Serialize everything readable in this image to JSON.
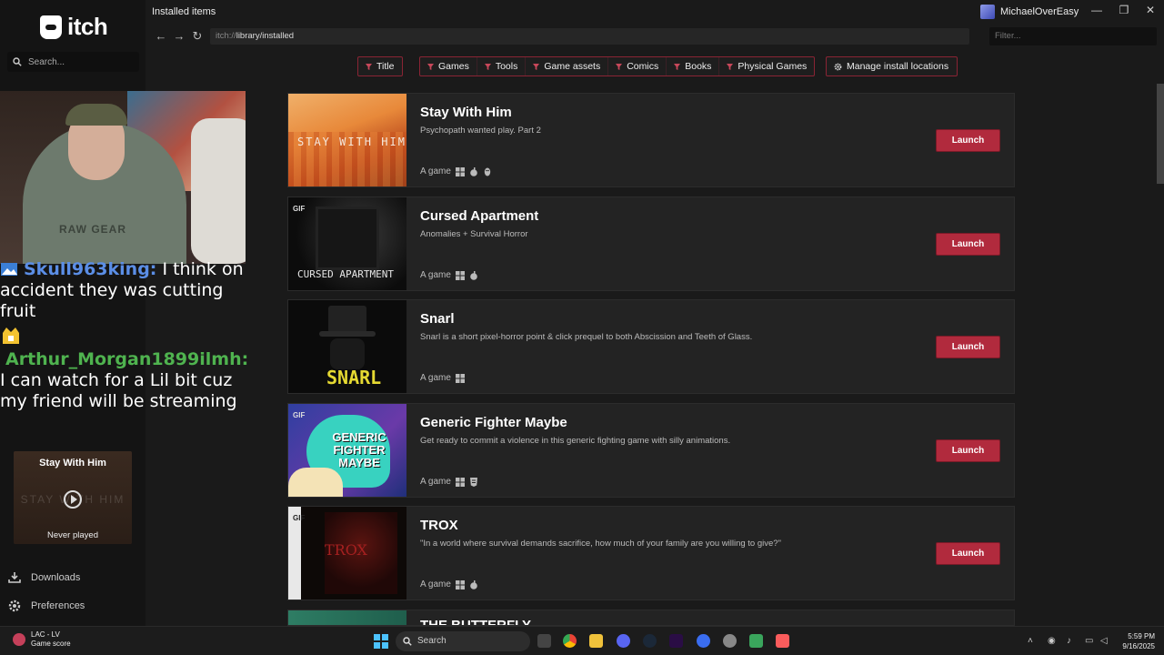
{
  "app": {
    "logo_text": "itch",
    "page_title": "Installed items",
    "url_proto": "itch://",
    "url_path": "library/installed",
    "filter_placeholder": "Filter...",
    "username": "MichaelOverEasy"
  },
  "sidebar": {
    "search_placeholder": "Search...",
    "downloads_label": "Downloads",
    "preferences_label": "Preferences",
    "now_playing": {
      "title": "Stay With Him",
      "status": "Never played",
      "ghost": "STAY WITH HIM"
    }
  },
  "chat": {
    "line1_user": "Skull963king:",
    "line1_text": " I think on accident they was cutting fruit",
    "line2_user": "Arthur_Morgan1899ilmh:",
    "line2_text": "I can watch for a Lil bit cuz my friend will be streaming"
  },
  "webcam": {
    "shirt_print": "RAW GEAR"
  },
  "filters": {
    "title": "Title",
    "categories": [
      "Games",
      "Tools",
      "Game assets",
      "Comics",
      "Books",
      "Physical Games"
    ],
    "manage": "Manage install locations"
  },
  "games": [
    {
      "title": "Stay With Him",
      "desc": "Psychopath wanted play. Part 2",
      "kind": "A game",
      "platforms": [
        "windows",
        "apple",
        "linux"
      ],
      "gif": "",
      "thumb_text": "STAY WITH HIM",
      "launch": "Launch"
    },
    {
      "title": "Cursed Apartment",
      "desc": "Anomalies + Survival Horror",
      "kind": "A game",
      "platforms": [
        "windows",
        "apple"
      ],
      "gif": "GIF",
      "thumb_text": "CURSED APARTMENT",
      "launch": "Launch"
    },
    {
      "title": "Snarl",
      "desc": "Snarl is a short pixel-horror point & click prequel to both Abscission and Teeth of Glass.",
      "kind": "A game",
      "platforms": [
        "windows"
      ],
      "gif": "",
      "thumb_text": "SNARL",
      "launch": "Launch"
    },
    {
      "title": "Generic Fighter Maybe",
      "desc": "Get ready to commit a violence in this generic fighting game with silly animations.",
      "kind": "A game",
      "platforms": [
        "windows",
        "html5"
      ],
      "gif": "GIF",
      "thumb_text": "GENERIC FIGHTER MAYBE",
      "launch": "Launch"
    },
    {
      "title": "TROX",
      "desc": "\"In a world where survival demands sacrifice, how much of your family are you willing to give?\"",
      "kind": "A game",
      "platforms": [
        "windows",
        "apple"
      ],
      "gif": "GIF",
      "thumb_text": "TROX",
      "launch": "Launch"
    },
    {
      "title": "THE BUTTERFLY",
      "desc": "",
      "kind": "",
      "platforms": [],
      "gif": "",
      "thumb_text": "",
      "launch": ""
    }
  ],
  "taskbar": {
    "weather_title": "LAC - LV",
    "weather_sub": "Game score",
    "search_label": "Search",
    "time": "5:59 PM",
    "date": "9/16/2025"
  },
  "colors": {
    "accent": "#b12a3d",
    "chip_border": "#8a2434",
    "bg": "#1a1a1a",
    "row_bg": "#232323"
  }
}
